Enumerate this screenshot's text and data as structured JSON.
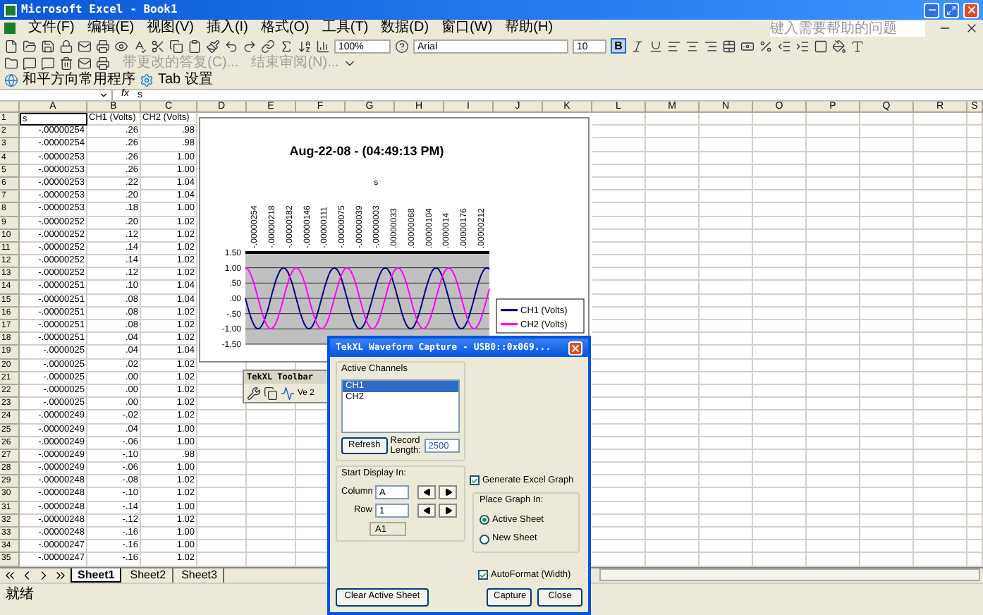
{
  "window": {
    "title": "Microsoft Excel - Book1"
  },
  "menu": [
    {
      "label": "文件(F)"
    },
    {
      "label": "编辑(E)"
    },
    {
      "label": "视图(V)"
    },
    {
      "label": "插入(I)"
    },
    {
      "label": "格式(O)"
    },
    {
      "label": "工具(T)"
    },
    {
      "label": "数据(D)"
    },
    {
      "label": "窗口(W)"
    },
    {
      "label": "帮助(H)"
    }
  ],
  "help_search": {
    "placeholder": "键入需要帮助的问题"
  },
  "toolbar": {
    "zoom": "100%",
    "font": "Arial",
    "size": "10",
    "bold_label": "B",
    "bold_on": true
  },
  "review_toolbar": {
    "items": [
      "带更改的答复(C)...",
      "结束审阅(N)..."
    ]
  },
  "web_toolbar": {
    "items": [
      "和平方向常用程序",
      "Tab 设置"
    ]
  },
  "formula_bar": {
    "fx_label": "fx",
    "value": "s"
  },
  "sheet": {
    "columns": [
      "A",
      "B",
      "C",
      "D",
      "E",
      "F",
      "G",
      "H",
      "I",
      "J",
      "K",
      "L",
      "M",
      "N",
      "O",
      "P",
      "Q",
      "R",
      "S"
    ],
    "rows": [
      {
        "header": "1",
        "cells": [
          "s",
          "CH1 (Volts)",
          "CH2 (Volts)"
        ],
        "selected": true
      },
      {
        "header": "2",
        "cells": [
          "-.00000254",
          ".26",
          ".98"
        ],
        "selected": false
      },
      {
        "header": "3",
        "cells": [
          "-.00000254",
          ".26",
          ".98"
        ],
        "selected": false
      },
      {
        "header": "4",
        "cells": [
          "-.00000253",
          ".26",
          "1.00"
        ],
        "selected": false
      },
      {
        "header": "5",
        "cells": [
          "-.00000253",
          ".26",
          "1.00"
        ],
        "selected": false
      },
      {
        "header": "6",
        "cells": [
          "-.00000253",
          ".22",
          "1.04"
        ],
        "selected": false
      },
      {
        "header": "7",
        "cells": [
          "-.00000253",
          ".20",
          "1.04"
        ],
        "selected": false
      },
      {
        "header": "8",
        "cells": [
          "-.00000253",
          ".18",
          "1.00"
        ],
        "selected": false
      },
      {
        "header": "9",
        "cells": [
          "-.00000252",
          ".20",
          "1.02"
        ],
        "selected": false
      },
      {
        "header": "10",
        "cells": [
          "-.00000252",
          ".12",
          "1.02"
        ],
        "selected": false
      },
      {
        "header": "11",
        "cells": [
          "-.00000252",
          ".14",
          "1.02"
        ],
        "selected": false
      },
      {
        "header": "12",
        "cells": [
          "-.00000252",
          ".14",
          "1.02"
        ],
        "selected": false
      },
      {
        "header": "13",
        "cells": [
          "-.00000252",
          ".12",
          "1.02"
        ],
        "selected": false
      },
      {
        "header": "14",
        "cells": [
          "-.00000251",
          ".10",
          "1.04"
        ],
        "selected": false
      },
      {
        "header": "15",
        "cells": [
          "-.00000251",
          ".08",
          "1.04"
        ],
        "selected": false
      },
      {
        "header": "16",
        "cells": [
          "-.00000251",
          ".08",
          "1.02"
        ],
        "selected": false
      },
      {
        "header": "17",
        "cells": [
          "-.00000251",
          ".08",
          "1.02"
        ],
        "selected": false
      },
      {
        "header": "18",
        "cells": [
          "-.00000251",
          ".04",
          "1.02"
        ],
        "selected": false
      },
      {
        "header": "19",
        "cells": [
          "-.0000025",
          ".04",
          "1.04"
        ],
        "selected": false
      },
      {
        "header": "20",
        "cells": [
          "-.0000025",
          ".02",
          "1.02"
        ],
        "selected": false
      },
      {
        "header": "21",
        "cells": [
          "-.0000025",
          ".00",
          "1.02"
        ],
        "selected": false
      },
      {
        "header": "22",
        "cells": [
          "-.0000025",
          ".00",
          "1.02"
        ],
        "selected": false
      },
      {
        "header": "23",
        "cells": [
          "-.0000025",
          ".00",
          "1.02"
        ],
        "selected": false
      },
      {
        "header": "24",
        "cells": [
          "-.00000249",
          "-.02",
          "1.02"
        ],
        "selected": false
      },
      {
        "header": "25",
        "cells": [
          "-.00000249",
          ".04",
          "1.00"
        ],
        "selected": false
      },
      {
        "header": "26",
        "cells": [
          "-.00000249",
          "-.06",
          "1.00"
        ],
        "selected": false
      },
      {
        "header": "27",
        "cells": [
          "-.00000249",
          "-.10",
          ".98"
        ],
        "selected": false
      },
      {
        "header": "28",
        "cells": [
          "-.00000249",
          "-.06",
          "1.00"
        ],
        "selected": false
      },
      {
        "header": "29",
        "cells": [
          "-.00000248",
          "-.08",
          "1.02"
        ],
        "selected": false
      },
      {
        "header": "30",
        "cells": [
          "-.00000248",
          "-.10",
          "1.02"
        ],
        "selected": false
      },
      {
        "header": "31",
        "cells": [
          "-.00000248",
          "-.14",
          "1.00"
        ],
        "selected": false
      },
      {
        "header": "32",
        "cells": [
          "-.00000248",
          "-.12",
          "1.02"
        ],
        "selected": false
      },
      {
        "header": "33",
        "cells": [
          "-.00000248",
          "-.16",
          "1.00"
        ],
        "selected": false
      },
      {
        "header": "34",
        "cells": [
          "-.00000247",
          "-.16",
          "1.00"
        ],
        "selected": false
      },
      {
        "header": "35",
        "cells": [
          "-.00000247",
          "-.16",
          "1.02"
        ],
        "selected": false
      }
    ]
  },
  "chart": {
    "title": "Aug-22-08 - (04:49:13 PM)",
    "marker_label": "s",
    "x_labels": [
      "-.00000254",
      "-.00000218",
      "-.00000182",
      "-.00000146",
      "-.00000111",
      "-.00000075",
      "-.00000039",
      "-.00000003",
      ".00000033",
      ".00000068",
      ".00000104",
      ".0000014",
      ".00000176",
      ".00000212"
    ],
    "y_labels": [
      "1.50",
      "1.00",
      ".50",
      ".00",
      "-.50",
      "-1.00",
      "-1.50"
    ],
    "legend": [
      {
        "name": "CH1 (Volts)",
        "color": "#000080"
      },
      {
        "name": "CH2 (Volts)",
        "color": "#ff00ff"
      }
    ]
  },
  "floating_toolbar": {
    "title": "TekXL Toolbar",
    "text": "Ve 2"
  },
  "dialog": {
    "title": "TekXL Waveform Capture - USB0::0x069...",
    "channels_group": "Active Channels",
    "channels": [
      {
        "label": "CH1",
        "selected": true
      },
      {
        "label": "CH2",
        "selected": false
      }
    ],
    "refresh": "Refresh",
    "record_length_label": "Record Length:",
    "record_length": "2500",
    "start_group": "Start Display In:",
    "column_label": "Column",
    "column": "A",
    "row_label": "Row",
    "row": "1",
    "cell": "A1",
    "generate_graph": {
      "label": "Generate Excel Graph",
      "checked": true
    },
    "place_group": "Place Graph In:",
    "place_options": [
      {
        "label": "Active Sheet",
        "selected": true
      },
      {
        "label": "New Sheet",
        "selected": false
      }
    ],
    "autoformat": {
      "label": "AutoFormat (Width)",
      "checked": true
    },
    "buttons": [
      "Clear Active Sheet",
      "Capture",
      "Close"
    ]
  },
  "sheet_tabs": [
    {
      "label": "Sheet1",
      "selected": true
    },
    {
      "label": "Sheet2",
      "selected": false
    },
    {
      "label": "Sheet3",
      "selected": false
    }
  ],
  "status_bar": {
    "text": "就绪"
  }
}
